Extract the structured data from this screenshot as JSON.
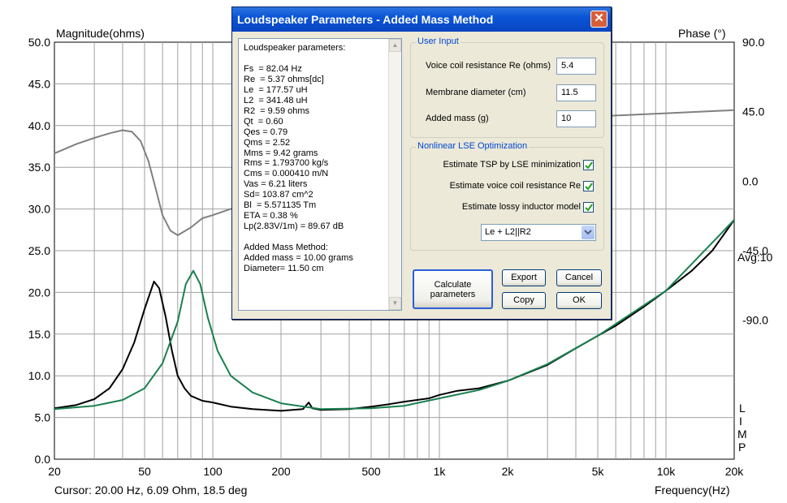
{
  "chart": {
    "left_axis_title": "Magnitude(ohms)",
    "right_axis_title": "Phase (°)",
    "x_axis_title": "Frequency(Hz)",
    "cursor_readout": "Cursor: 20.00 Hz, 6.09 Ohm, 18.5 deg",
    "avg_label": "Avg:10",
    "limp_letters": [
      "L",
      "I",
      "M",
      "P"
    ],
    "colors": {
      "magnitude": "#000000",
      "model": "#1a8050",
      "phase": "#808080",
      "grid": "#a0a0a0"
    }
  },
  "chart_data": {
    "type": "line",
    "x_scale": "log",
    "xlim": [
      20,
      20000
    ],
    "x_ticks": [
      "20",
      "50",
      "100",
      "200",
      "500",
      "1k",
      "2k",
      "5k",
      "10k",
      "20k"
    ],
    "ylim_left": [
      0,
      50
    ],
    "y_ticks_left": [
      "50.0",
      "45.0",
      "40.0",
      "35.0",
      "30.0",
      "25.0",
      "20.0",
      "15.0",
      "10.0",
      "5.0",
      "0.0"
    ],
    "ylim_right": [
      -180,
      90
    ],
    "y_ticks_right": [
      "90.0",
      "45.0",
      "0.0",
      "-45.0",
      "-90.0"
    ],
    "grid": true,
    "series": [
      {
        "axis": "left",
        "color": "#000000",
        "points": [
          [
            20,
            6.1
          ],
          [
            25,
            6.5
          ],
          [
            30,
            7.2
          ],
          [
            35,
            8.5
          ],
          [
            40,
            10.8
          ],
          [
            45,
            14
          ],
          [
            50,
            18
          ],
          [
            55,
            21.3
          ],
          [
            58,
            20.5
          ],
          [
            62,
            17
          ],
          [
            66,
            13
          ],
          [
            70,
            10
          ],
          [
            75,
            8.5
          ],
          [
            80,
            7.6
          ],
          [
            90,
            7.0
          ],
          [
            100,
            6.8
          ],
          [
            120,
            6.3
          ],
          [
            150,
            6.0
          ],
          [
            200,
            5.8
          ],
          [
            250,
            6.0
          ],
          [
            265,
            6.8
          ],
          [
            275,
            6.1
          ],
          [
            300,
            5.9
          ],
          [
            400,
            6.0
          ],
          [
            500,
            6.3
          ],
          [
            600,
            6.6
          ],
          [
            700,
            6.9
          ],
          [
            900,
            7.3
          ],
          [
            1000,
            7.7
          ],
          [
            1200,
            8.2
          ],
          [
            1500,
            8.5
          ],
          [
            2000,
            9.4
          ],
          [
            3000,
            11.3
          ],
          [
            4000,
            13.3
          ],
          [
            5000,
            14.8
          ],
          [
            6000,
            16.0
          ],
          [
            8000,
            18.3
          ],
          [
            10000,
            20.2
          ],
          [
            13000,
            22.6
          ],
          [
            16000,
            25.0
          ],
          [
            20000,
            28.7
          ]
        ]
      },
      {
        "axis": "left",
        "color": "#1a8050",
        "points": [
          [
            20,
            6.0
          ],
          [
            30,
            6.4
          ],
          [
            40,
            7.1
          ],
          [
            50,
            8.5
          ],
          [
            60,
            11.5
          ],
          [
            70,
            16.5
          ],
          [
            76,
            21
          ],
          [
            82,
            22.6
          ],
          [
            88,
            21
          ],
          [
            95,
            17
          ],
          [
            105,
            13
          ],
          [
            120,
            10
          ],
          [
            150,
            8.0
          ],
          [
            200,
            6.7
          ],
          [
            300,
            6.0
          ],
          [
            500,
            6.1
          ],
          [
            700,
            6.4
          ],
          [
            1000,
            7.3
          ],
          [
            1500,
            8.3
          ],
          [
            2000,
            9.4
          ],
          [
            3000,
            11.4
          ],
          [
            5000,
            14.8
          ],
          [
            10000,
            20.2
          ],
          [
            20000,
            28.7
          ]
        ]
      },
      {
        "axis": "right",
        "color": "#808080",
        "points": [
          [
            20,
            18
          ],
          [
            25,
            24
          ],
          [
            30,
            28
          ],
          [
            35,
            31
          ],
          [
            40,
            33
          ],
          [
            44,
            32
          ],
          [
            48,
            26
          ],
          [
            52,
            13
          ],
          [
            56,
            -5
          ],
          [
            60,
            -22
          ],
          [
            65,
            -32
          ],
          [
            70,
            -35
          ],
          [
            80,
            -30
          ],
          [
            90,
            -24
          ],
          [
            100,
            -22
          ],
          [
            120,
            -18
          ],
          [
            150,
            -12
          ],
          [
            200,
            -5
          ],
          [
            300,
            3
          ],
          [
            500,
            12
          ],
          [
            800,
            22
          ],
          [
            1000,
            27
          ],
          [
            2000,
            36
          ],
          [
            3000,
            40
          ],
          [
            5000,
            42
          ],
          [
            10000,
            44
          ],
          [
            20000,
            46
          ]
        ]
      }
    ]
  },
  "dialog": {
    "title": "Loudspeaker Parameters - Added Mass Method",
    "close_glyph": "✕",
    "results_lines": [
      "Loudspeaker parameters:",
      "",
      "Fs  = 82.04 Hz",
      "Re  = 5.37 ohms[dc]",
      "Le  = 177.57 uH",
      "L2  = 341.48 uH",
      "R2  = 9.59 ohms",
      "Qt  = 0.60",
      "Qes = 0.79",
      "Qms = 2.52",
      "Mms = 9.42 grams",
      "Rms = 1.793700 kg/s",
      "Cms = 0.000410 m/N",
      "Vas = 6.21 liters",
      "Sd= 103.87 cm^2",
      "Bl  = 5.571135 Tm",
      "ETA = 0.38 %",
      "Lp(2.83V/1m) = 89.67 dB",
      "",
      "Added Mass Method:",
      "Added mass = 10.00 grams",
      "Diameter= 11.50 cm"
    ],
    "user_input": {
      "group_label": "User Input",
      "re_label": "Voice coil resistance Re (ohms)",
      "re_value": "5.4",
      "diameter_label": "Membrane diameter (cm)",
      "diameter_value": "11.5",
      "mass_label": "Added mass (g)",
      "mass_value": "10"
    },
    "optimization": {
      "group_label": "Nonlinear LSE Optimization",
      "opt1": "Estimate TSP by LSE minimization",
      "opt2": "Estimate voice coil resistance Re",
      "opt3": "Estimate lossy inductor model",
      "model_select": "Le + L2||R2"
    },
    "buttons": {
      "calculate_line1": "Calculate",
      "calculate_line2": "parameters",
      "export": "Export",
      "cancel": "Cancel",
      "copy": "Copy",
      "ok": "OK"
    }
  }
}
